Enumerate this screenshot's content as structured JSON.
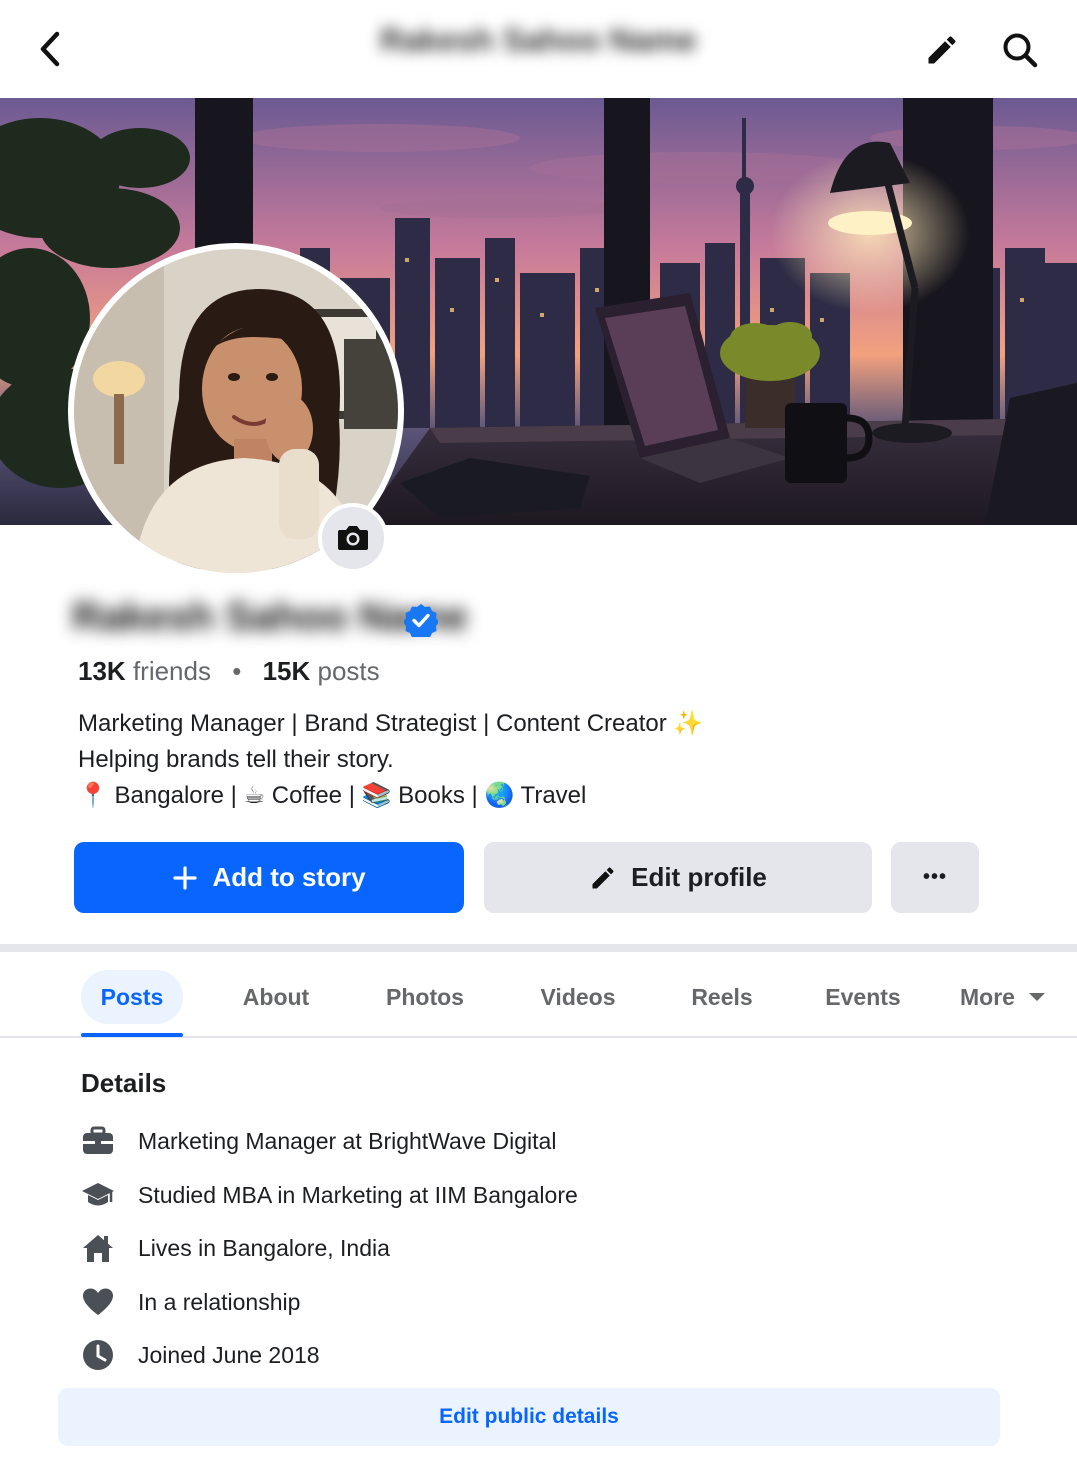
{
  "header": {
    "title": "Rakesh Sahoo Name",
    "back_icon": "back-arrow-icon",
    "edit_icon": "pencil-icon",
    "search_icon": "search-icon"
  },
  "profile": {
    "name": "Rakesh Sahoo Name",
    "verified": true,
    "friends_count": "13K",
    "friends_label": "friends",
    "separator": "•",
    "posts_count": "15K",
    "posts_label": "posts",
    "bio_line1": "Marketing Manager | Brand Strategist | Content Creator ✨",
    "bio_line2": "Helping brands tell their story.",
    "bio_line3_items": [
      "📍 Bangalore",
      "☕ Coffee",
      "📚 Books",
      "🌏 Travel"
    ],
    "bio_line3_separator": "|"
  },
  "actions": {
    "add_story_label": "Add to story",
    "edit_profile_label": "Edit profile",
    "more_label": "•••"
  },
  "tabs": [
    {
      "label": "Posts",
      "active": true
    },
    {
      "label": "About",
      "active": false
    },
    {
      "label": "Photos",
      "active": false
    },
    {
      "label": "Videos",
      "active": false
    },
    {
      "label": "Reels",
      "active": false
    },
    {
      "label": "Events",
      "active": false
    },
    {
      "label": "More",
      "active": false
    }
  ],
  "details": {
    "title": "Details",
    "items": [
      {
        "icon": "briefcase-icon",
        "text": "Marketing Manager at BrightWave Digital"
      },
      {
        "icon": "graduation-cap-icon",
        "text": "Studied MBA in Marketing at IIM Bangalore"
      },
      {
        "icon": "home-icon",
        "text": "Lives in Bangalore, India"
      },
      {
        "icon": "heart-icon",
        "text": "In a relationship"
      },
      {
        "icon": "clock-icon",
        "text": "Joined June 2018"
      }
    ],
    "edit_button_label": "Edit public details"
  },
  "colors": {
    "primary": "#0866ff",
    "secondary_bg": "#e4e6eb",
    "muted_text": "#65676b",
    "tab_active_bg": "#ebf3ff"
  }
}
